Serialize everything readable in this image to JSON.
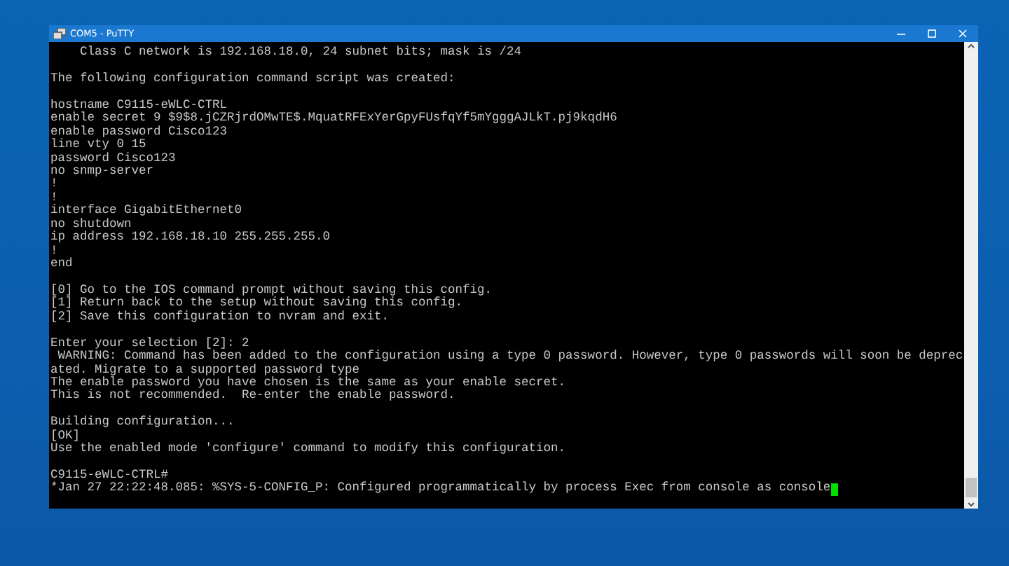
{
  "window": {
    "title": "COM5 - PuTTY"
  },
  "terminal": {
    "blocks": [
      {
        "lines": [
          "    Class C network is 192.168.18.0, 24 subnet bits; mask is /24"
        ]
      },
      {
        "lines": [
          "The following configuration command script was created:"
        ]
      },
      {
        "lines": [
          "hostname C9115-eWLC-CTRL",
          "enable secret 9 $9$8.jCZRjrdOMwTE$.MquatRFExYerGpyFUsfqYf5mYgggAJLkT.pj9kqdH6",
          "enable password Cisco123",
          "line vty 0 15",
          "password Cisco123",
          "no snmp-server",
          "!",
          "!",
          "interface GigabitEthernet0",
          "no shutdown",
          "ip address 192.168.18.10 255.255.255.0",
          "!",
          "end"
        ]
      },
      {
        "lines": [
          "[0] Go to the IOS command prompt without saving this config.",
          "[1] Return back to the setup without saving this config.",
          "[2] Save this configuration to nvram and exit."
        ]
      },
      {
        "lines": [
          "Enter your selection [2]: 2",
          " WARNING: Command has been added to the configuration using a type 0 password. However, type 0 passwords will soon be deprec",
          "ated. Migrate to a supported password type",
          "The enable password you have chosen is the same as your enable secret.",
          "This is not recommended.  Re-enter the enable password."
        ]
      },
      {
        "lines": [
          "Building configuration...",
          "[OK]",
          "Use the enabled mode 'configure' command to modify this configuration."
        ]
      },
      {
        "lines": [
          "C9115-eWLC-CTRL#",
          "*Jan 27 22:22:48.085: %SYS-5-CONFIG_P: Configured programmatically by process Exec from console as console"
        ]
      }
    ]
  }
}
